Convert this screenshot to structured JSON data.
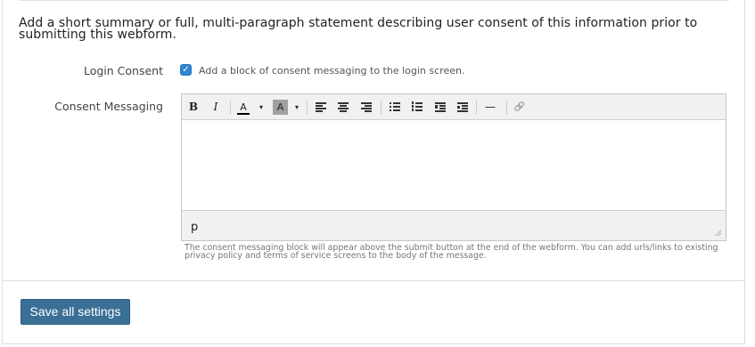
{
  "intro_text": "Add a short summary or full, multi-paragraph statement describing user consent of this information prior to submitting this webform.",
  "login_consent": {
    "label": "Login Consent",
    "checked": true,
    "checkbox_text": "Add a block of consent messaging to the login screen."
  },
  "consent_messaging": {
    "label": "Consent Messaging",
    "toolbar": {
      "bold": "B",
      "italic": "I",
      "text_color": "A",
      "background_color": "A",
      "caret": "▾",
      "horizontal_rule": "—",
      "link": "🔗"
    },
    "statusbar_path": "p",
    "help_text": "The consent messaging block will appear above the submit button at the end of the webform. You can add urls/links to existing privacy policy and terms of service screens to the body of the message."
  },
  "save_button": "Save all settings",
  "colors": {
    "accent": "#2f86d1",
    "button": "#3a6f96"
  }
}
